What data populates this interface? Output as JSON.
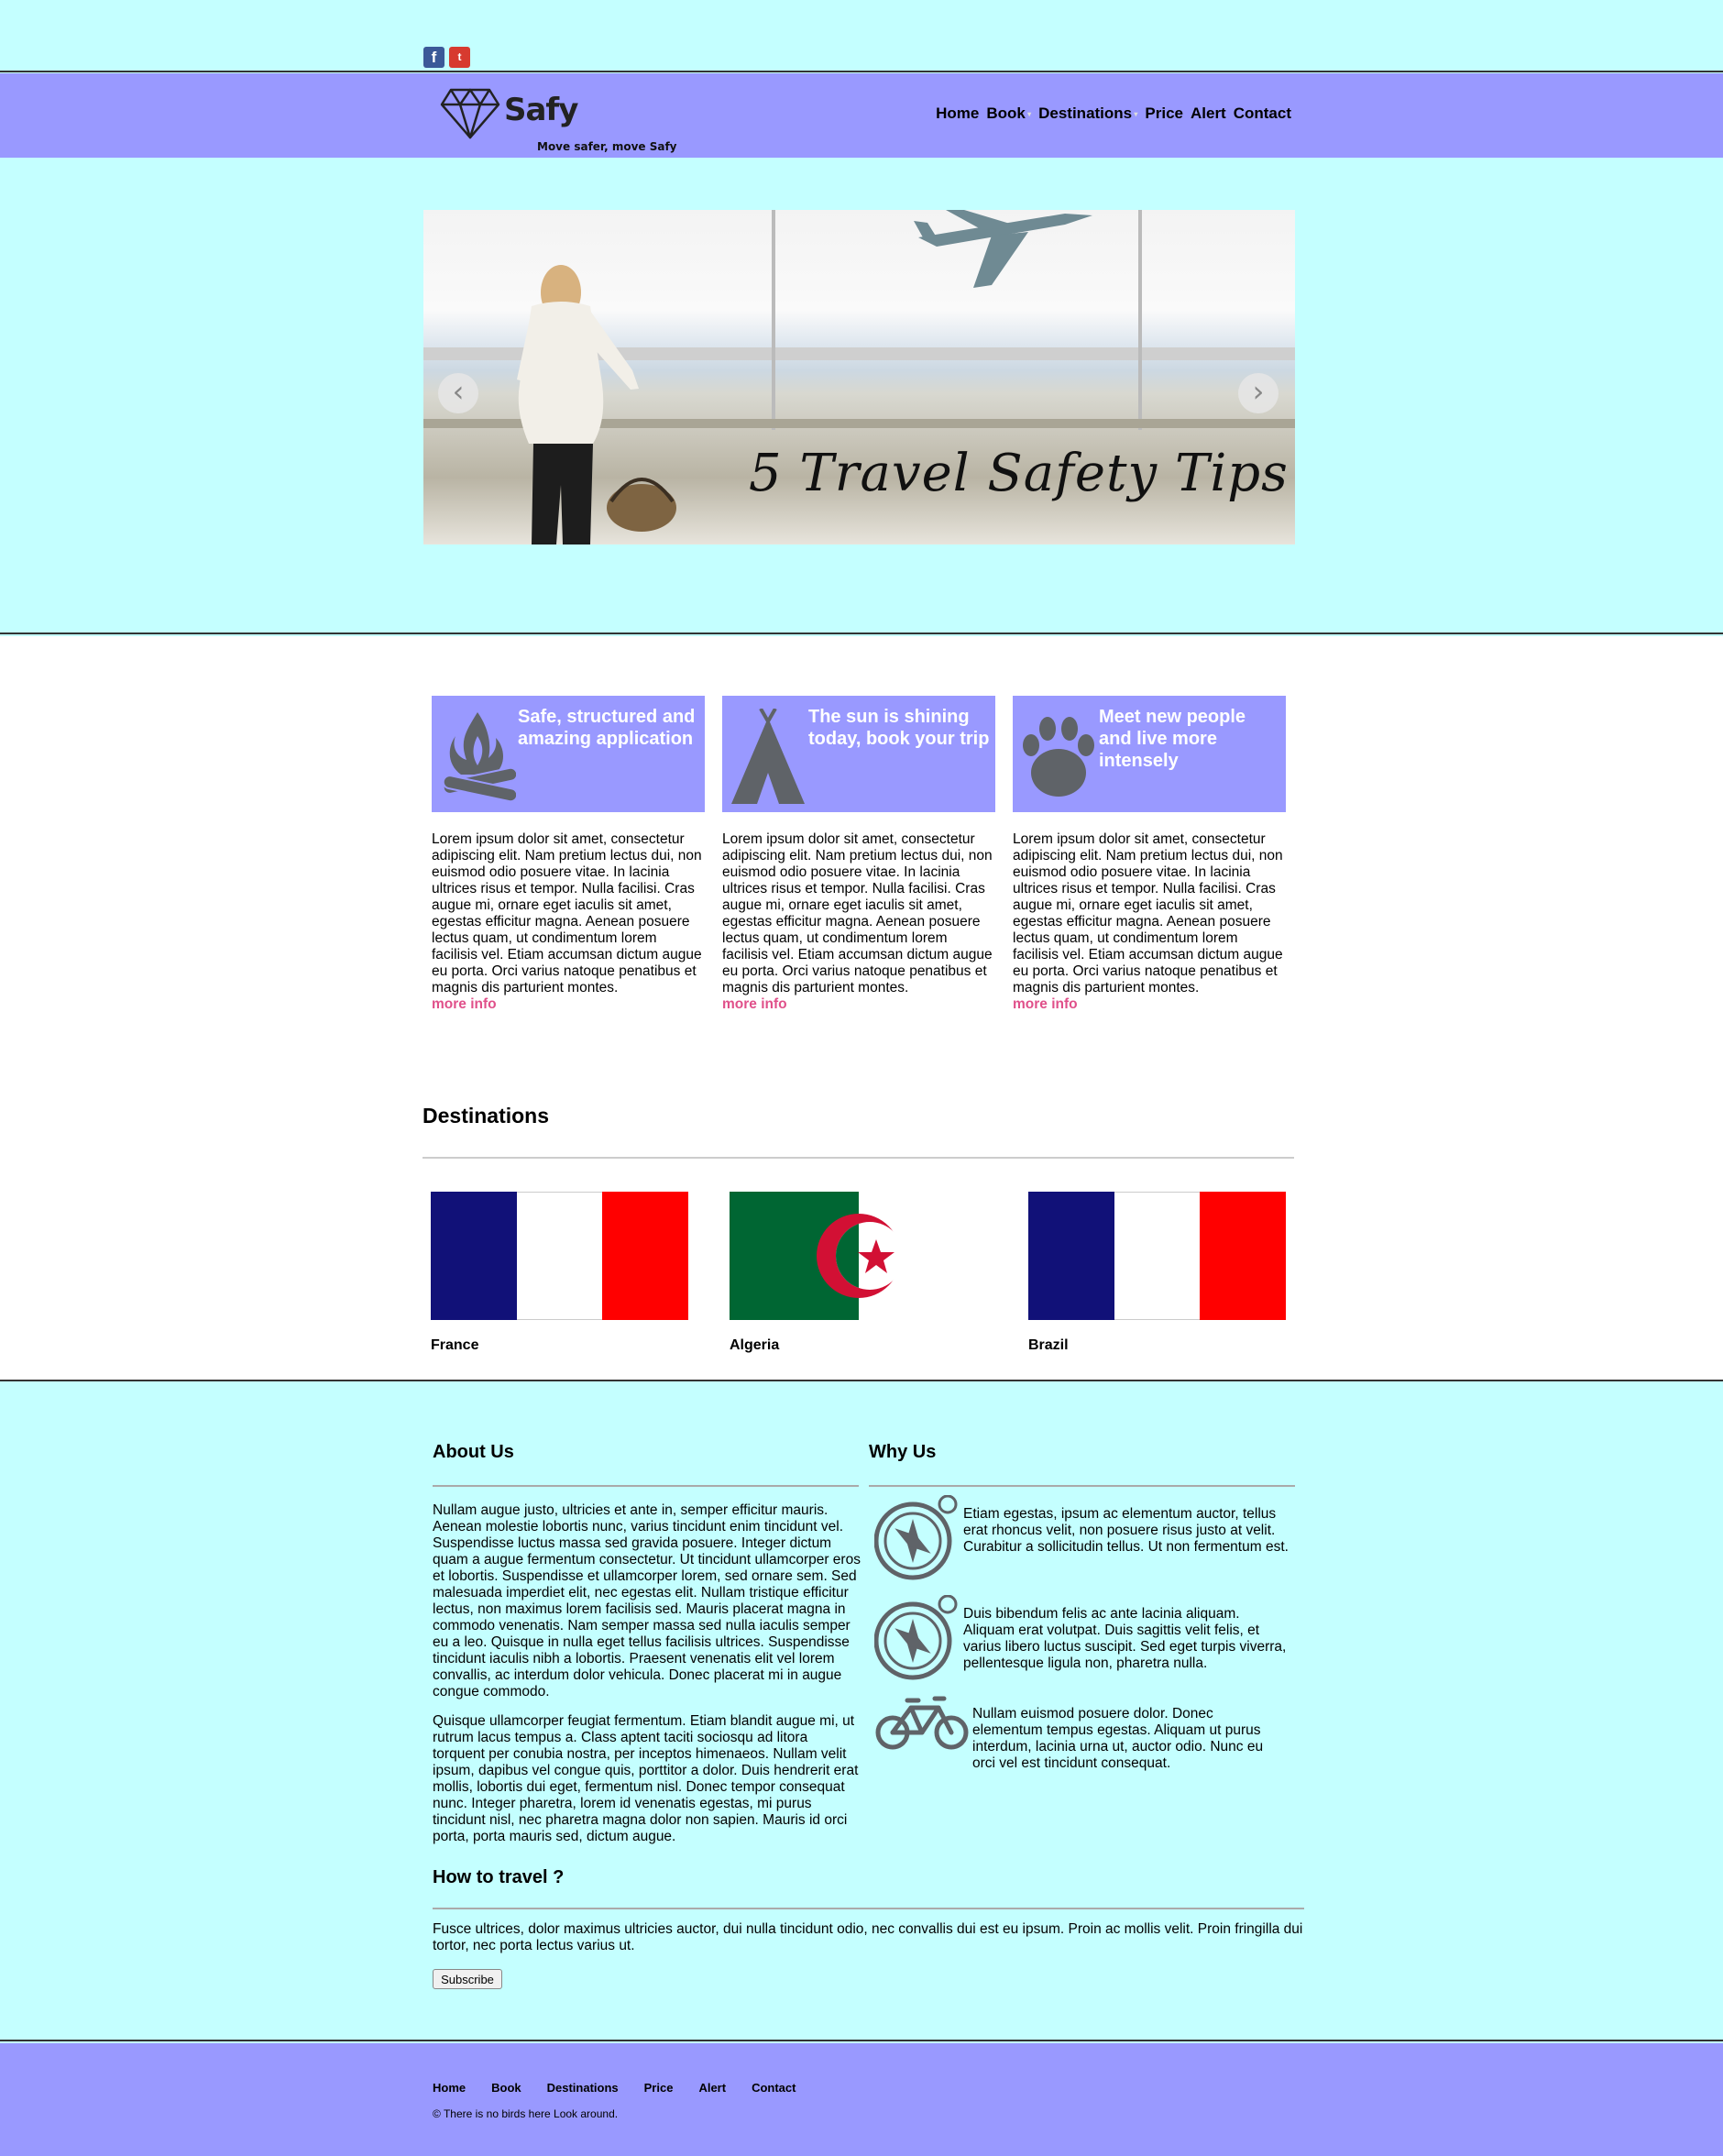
{
  "social": {
    "facebook": "f",
    "twitter": "t"
  },
  "header": {
    "brand": "Safy",
    "tagline": "Move safer, move Safy",
    "nav": [
      "Home",
      "Book",
      "Destinations",
      "Price",
      "Alert",
      "Contact"
    ]
  },
  "slider": {
    "caption": "5 Travel Safety Tips",
    "prev": "‹",
    "next": "›",
    "slide_count": 5,
    "active_slide": 1
  },
  "features": [
    {
      "title": "Safe, structured and amazing application",
      "icon": "campfire-icon",
      "text": "Lorem ipsum dolor sit amet, consectetur adipiscing elit. Nam pretium lectus dui, non euismod odio posuere vitae. In lacinia ultrices risus et tempor. Nulla facilisi. Cras augue mi, ornare eget iaculis sit amet, egestas efficitur magna. Aenean posuere lectus quam, ut condimentum lorem facilisis vel. Etiam accumsan dictum augue eu porta. Orci varius natoque penatibus et magnis dis parturient montes.",
      "link": "more info"
    },
    {
      "title": "The sun is shining today, book your trip",
      "icon": "tent-icon",
      "text": "Lorem ipsum dolor sit amet, consectetur adipiscing elit. Nam pretium lectus dui, non euismod odio posuere vitae. In lacinia ultrices risus et tempor. Nulla facilisi. Cras augue mi, ornare eget iaculis sit amet, egestas efficitur magna. Aenean posuere lectus quam, ut condimentum lorem facilisis vel. Etiam accumsan dictum augue eu porta. Orci varius natoque penatibus et magnis dis parturient montes.",
      "link": "more info"
    },
    {
      "title": "Meet new people and live more intensely",
      "icon": "paw-icon",
      "text": "Lorem ipsum dolor sit amet, consectetur adipiscing elit. Nam pretium lectus dui, non euismod odio posuere vitae. In lacinia ultrices risus et tempor. Nulla facilisi. Cras augue mi, ornare eget iaculis sit amet, egestas efficitur magna. Aenean posuere lectus quam, ut condimentum lorem facilisis vel. Etiam accumsan dictum augue eu porta. Orci varius natoque penatibus et magnis dis parturient montes.",
      "link": "more info"
    }
  ],
  "destinations": {
    "title": "Destinations",
    "items": [
      {
        "name": "France",
        "flag": "french-flag"
      },
      {
        "name": "Algeria",
        "flag": "algerian-flag"
      },
      {
        "name": "Brazil",
        "flag": "french-flag"
      }
    ]
  },
  "about": {
    "title": "About Us",
    "p1": "Nullam augue justo, ultricies et ante in, semper efficitur mauris. Aenean molestie lobortis nunc, varius tincidunt enim tincidunt vel. Suspendisse luctus massa sed gravida posuere. Integer dictum quam a augue fermentum consectetur. Ut tincidunt ullamcorper eros et lobortis. Suspendisse et ullamcorper lorem, sed ornare sem. Sed malesuada imperdiet elit, nec egestas elit. Nullam tristique efficitur lectus, non maximus lorem facilisis sed. Mauris placerat magna in commodo venenatis. Nam semper massa sed nulla iaculis semper eu a leo. Quisque in nulla eget tellus facilisis ultrices. Suspendisse tincidunt iaculis nibh a lobortis. Praesent venenatis elit vel lorem convallis, ac interdum dolor vehicula. Donec placerat mi in augue congue commodo.",
    "p2": "Quisque ullamcorper feugiat fermentum. Etiam blandit augue mi, ut rutrum lacus tempus a. Class aptent taciti sociosqu ad litora torquent per conubia nostra, per inceptos himenaeos. Nullam velit ipsum, dapibus vel congue quis, porttitor a dolor. Duis hendrerit erat mollis, lobortis dui eget, fermentum nisl. Donec tempor consequat nunc. Integer pharetra, lorem id venenatis egestas, mi purus tincidunt nisl, nec pharetra magna dolor non sapien. Mauris id orci porta, porta mauris sed, dictum augue."
  },
  "why": {
    "title": "Why Us",
    "items": [
      {
        "icon": "compass-icon",
        "text": "Etiam egestas, ipsum ac elementum auctor, tellus erat rhoncus velit, non posuere risus justo at velit. Curabitur a sollicitudin tellus. Ut non fermentum est."
      },
      {
        "icon": "compass-icon",
        "text": "Duis bibendum felis ac ante lacinia aliquam. Aliquam erat volutpat. Duis sagittis velit felis, et varius libero luctus suscipit. Sed eget turpis viverra, pellentesque ligula non, pharetra nulla."
      },
      {
        "icon": "bicycle-icon",
        "text": "Nullam euismod posuere dolor. Donec elementum tempus egestas. Aliquam ut purus interdum, lacinia urna ut, auctor odio. Nunc eu orci vel est tincidunt consequat."
      }
    ]
  },
  "travel": {
    "title": "How to travel ?",
    "text": "Fusce ultrices, dolor maximus ultricies auctor, dui nulla tincidunt odio, nec convallis dui est eu ipsum. Proin ac mollis velit. Proin fringilla dui tortor, nec porta lectus varius ut.",
    "button": "Subscribe"
  },
  "footer": {
    "nav": [
      "Home",
      "Book",
      "Destinations",
      "Price",
      "Alert",
      "Contact"
    ],
    "copyright": "© There is no birds here Look around."
  },
  "colors": {
    "accent": "#9999ff",
    "background": "#c4ffff",
    "link": "#e0508a"
  }
}
